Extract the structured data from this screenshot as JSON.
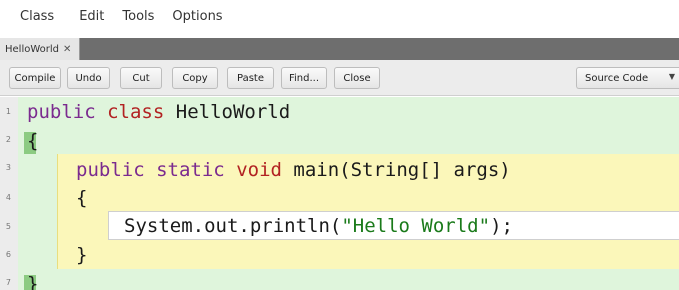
{
  "menu": [
    "Class",
    "Edit",
    "Tools",
    "Options"
  ],
  "tab": {
    "label": "HelloWorld",
    "close": "✕"
  },
  "toolbar": {
    "compile": "Compile",
    "undo": "Undo",
    "cut": "Cut",
    "copy": "Copy",
    "paste": "Paste",
    "find": "Find...",
    "close": "Close",
    "view_mode": "Source Code"
  },
  "editor": {
    "line_numbers": [
      "1",
      "2",
      "3",
      "4",
      "5",
      "6",
      "7"
    ],
    "line1": {
      "kw1": "public",
      "kw2": "class",
      "name": "HelloWorld"
    },
    "line2": {
      "brace": "{"
    },
    "line3": {
      "kw1": "public",
      "kw2": "static",
      "kw3": "void",
      "rest": "main(String[] args)"
    },
    "line4": {
      "brace": "{"
    },
    "line5": {
      "pre": "System.out.println(",
      "str": "\"Hello World\"",
      "post": ");"
    },
    "line6": {
      "brace": "}"
    },
    "line7": {
      "brace": "}"
    }
  },
  "colors": {
    "keyword": "#7b2b8f",
    "keyword_type": "#b22222",
    "string": "#1a7a1a",
    "class_scope_bg": "#dff5dc",
    "method_scope_bg": "#fbf7ba"
  }
}
